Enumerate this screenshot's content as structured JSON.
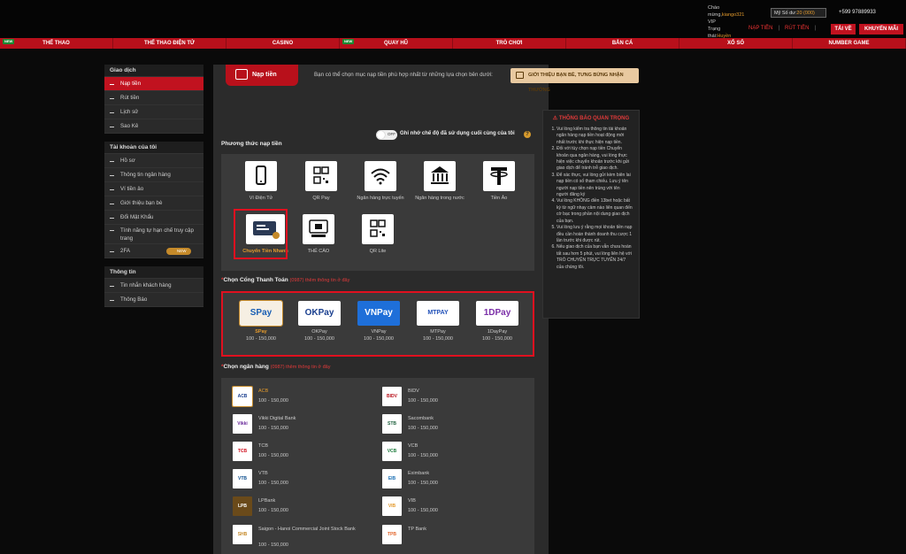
{
  "header": {
    "welcome_prefix": "Chào mừng,",
    "username": "kiango321",
    "vip_prefix": "VIP Trạng thái:",
    "vip_level": "Huyền Vũ",
    "balance_label": "Mỹ Số dư:",
    "balance_value": "20 (000)",
    "phone": "+599 97889933",
    "links": [
      "NẠP TIỀN",
      "RÚT TIỀN"
    ],
    "download_btn": "TẢI VỀ",
    "promo_btn": "KHUYẾN MÃI"
  },
  "main_nav": [
    {
      "label": "THỂ THAO",
      "badge": "NEW"
    },
    {
      "label": "THỂ THAO ĐIỆN TỬ",
      "badge": ""
    },
    {
      "label": "CASINO",
      "badge": ""
    },
    {
      "label": "QUAY HŨ",
      "badge": "NEW"
    },
    {
      "label": "TRÒ CHƠI",
      "badge": ""
    },
    {
      "label": "BẮN CÁ",
      "badge": ""
    },
    {
      "label": "XỔ SỐ",
      "badge": ""
    },
    {
      "label": "NUMBER GAME",
      "badge": ""
    }
  ],
  "sidebar": {
    "groups": [
      {
        "title": "Giao dịch",
        "items": [
          "Nạp tiền",
          "Rút tiền",
          "Lịch sử",
          "Sao Kê"
        ]
      },
      {
        "title": "Tài khoản của tôi",
        "items": [
          "Hồ sơ",
          "Thông tin ngân hàng",
          "Ví tiền ảo",
          "Giới thiệu bạn bè",
          "Đổi Mật Khẩu",
          "Tính năng tự hạn chế truy cập trang",
          "2FA"
        ]
      },
      {
        "title": "Thông tin",
        "items": [
          "Tin nhắn khách hàng",
          "Thông Báo"
        ]
      }
    ],
    "badge_2fa": "NEW"
  },
  "main": {
    "tab_label": "Nạp tiền",
    "intro": "Bạn có thể chọn mục nạp tiền phù hợp nhất từ những lựa chọn bên dưới:",
    "referral_btn": "GIỚI THIỆU BẠN BÈ, TƯNG BỪNG NHẬN THƯỞNG",
    "toggle_state": "OFF",
    "remember_text": "Ghi nhớ chế độ đã sử dụng cuối cùng của tôi",
    "help_icon": "?",
    "methods_title": "Phương thức nạp tiền",
    "methods": [
      {
        "label": "Ví Điện Tử",
        "icon": "phone-icon"
      },
      {
        "label": "QR Pay",
        "icon": "qr-icon"
      },
      {
        "label": "Ngân hàng trực tuyến",
        "icon": "wifi-icon"
      },
      {
        "label": "Ngân hàng trong nước",
        "icon": "bank-icon"
      },
      {
        "label": "Tiền Ảo",
        "icon": "tether-icon"
      },
      {
        "label": "Chuyển Tiền Nhanh",
        "icon": "fast-transfer-icon"
      },
      {
        "label": "THẺ CÀO",
        "icon": "card-icon"
      },
      {
        "label": "QR Lite",
        "icon": "qr-icon"
      }
    ],
    "gateway_title_star": "*",
    "gateway_title": "Chọn Cổng Thanh Toán",
    "gateway_sub": "(0987) thêm thông tin ở đây",
    "gateways": [
      {
        "name": "SPay",
        "range": "100 - 150,000",
        "logo": "SPay",
        "color": "#1a5fb4"
      },
      {
        "name": "OKPay",
        "range": "100 - 150,000",
        "logo": "OKPay",
        "color": "#1a3f8f"
      },
      {
        "name": "VNPay",
        "range": "100 - 150,000",
        "logo": "VNPay",
        "color": "#1e6fd9"
      },
      {
        "name": "MTPay",
        "range": "100 - 150,000",
        "logo": "MTPAY",
        "color": "#1f4fb8"
      },
      {
        "name": "1DayPay",
        "range": "100 - 150,000",
        "logo": "1DPay",
        "color": "#7b2fa8"
      }
    ],
    "bank_title_star": "*",
    "bank_title": "Chọn ngân hàng",
    "bank_sub": "(0987) thêm thông tin ở đây",
    "banks": [
      {
        "name": "ACB",
        "range": "100 - 150,000",
        "logo": "ACB",
        "color": "#1b3f8f"
      },
      {
        "name": "BIDV",
        "range": "100 - 150,000",
        "logo": "BIDV",
        "color": "#b8101b"
      },
      {
        "name": "Vikki Digital Bank",
        "range": "100 - 150,000",
        "logo": "Vikki",
        "color": "#6a2a9a"
      },
      {
        "name": "Sacombank",
        "range": "100 - 150,000",
        "logo": "STB",
        "color": "#1b5e3b"
      },
      {
        "name": "TCB",
        "range": "100 - 150,000",
        "logo": "TCB",
        "color": "#d0101f"
      },
      {
        "name": "VCB",
        "range": "100 - 150,000",
        "logo": "VCB",
        "color": "#1b7a3b"
      },
      {
        "name": "VTB",
        "range": "100 - 150,000",
        "logo": "VTB",
        "color": "#0e4f8f"
      },
      {
        "name": "Eximbank",
        "range": "100 - 150,000",
        "logo": "EIB",
        "color": "#1a6fb4"
      },
      {
        "name": "LPBank",
        "range": "100 - 150,000",
        "logo": "LPB",
        "color": "#8a5a1a"
      },
      {
        "name": "VIB",
        "range": "100 - 150,000",
        "logo": "VIB",
        "color": "#e39a2d"
      },
      {
        "name": "Saigon - Hanoi Commercial Joint Stock Bank",
        "range": "100 - 150,000",
        "logo": "SHB",
        "color": "#c58a2a"
      },
      {
        "name": "TP Bank",
        "range": "",
        "logo": "TPB",
        "color": "#e3672d"
      }
    ]
  },
  "notice": {
    "title": "THÔNG BÁO QUAN TRỌNG",
    "items": [
      "Vui lòng kiểm tra thông tin tài khoản ngân hàng nạp tiền hoạt động mới nhất trước khi thực hiện nạp tiền.",
      "Đối với tùy chọn nạp tiền Chuyển khoản qua ngân hàng, vui lòng thực hiện việc chuyển khoản trước khi gửi giao dịch để tránh trễ giao dịch.",
      "Để xác thực, vui lòng gửi kèm biên lai nạp tiền có số tham chiếu. Lưu ý tên người nạp tiền nên trùng với tên người đăng ký",
      "Vui lòng KHÔNG điền 13bet hoặc bất kỳ từ ngữ nhạy cảm nào liên quan đến cờ bạc trong phần nội dung giao dịch của bạn.",
      "Vui lòng lưu ý rằng mọi khoản tiền nạp đều cần hoàn thành doanh thu cược 1 lần trước khi được rút.",
      "Nếu giao dịch của bạn vẫn chưa hoàn tất sau hơn 5 phút, vui lòng liên hệ với TRÒ CHUYỆN TRỰC TUYẾN 24/7 của chúng tôi."
    ]
  }
}
